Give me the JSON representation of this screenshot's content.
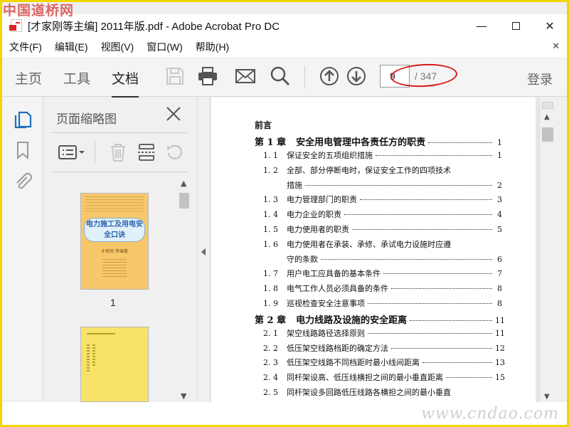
{
  "watermark": {
    "top": "中国道桥网",
    "bottom": "www.cndao.com"
  },
  "window": {
    "title": "[才家刚等主编] 2011年版.pdf - Adobe Acrobat Pro DC"
  },
  "menu": [
    "文件(F)",
    "编辑(E)",
    "视图(V)",
    "窗口(W)",
    "帮助(H)"
  ],
  "toolbar": {
    "tabs": [
      "主页",
      "工具",
      "文档"
    ],
    "active_tab": "文档",
    "current_page": "9",
    "total_pages": "/ 347",
    "login": "登录"
  },
  "thumbnails": {
    "title": "页面缩略图",
    "page1_title": "电力施工及用电安全口诀",
    "page1_author": "才家刚  等编著",
    "page1_number": "1"
  },
  "toc": {
    "heading": "前言",
    "entries": [
      {
        "type": "chapter",
        "num": "第 1 章",
        "text": "安全用电管理中各责任方的职责",
        "page": "1"
      },
      {
        "type": "section",
        "num": "1. 1",
        "text": "保证安全的五项组织措施",
        "page": "1"
      },
      {
        "type": "section",
        "num": "1. 2",
        "text": "全部、部分停断电时，保证安全工作的四项技术",
        "page": ""
      },
      {
        "type": "cont",
        "num": "",
        "text": "措施",
        "page": "2"
      },
      {
        "type": "section",
        "num": "1. 3",
        "text": "电力管理部门的职责",
        "page": "3"
      },
      {
        "type": "section",
        "num": "1. 4",
        "text": "电力企业的职责",
        "page": "4"
      },
      {
        "type": "section",
        "num": "1. 5",
        "text": "电力使用者的职责",
        "page": "5"
      },
      {
        "type": "section",
        "num": "1. 6",
        "text": "电力使用者在承装、承修、承试电力设施时应遵",
        "page": ""
      },
      {
        "type": "cont",
        "num": "",
        "text": "守的条款",
        "page": "6"
      },
      {
        "type": "section",
        "num": "1. 7",
        "text": "用户电工应具备的基本条件",
        "page": "7"
      },
      {
        "type": "section",
        "num": "1. 8",
        "text": "电气工作人员必须具备的条件",
        "page": "8"
      },
      {
        "type": "section",
        "num": "1. 9",
        "text": "巡视检查安全注意事项",
        "page": "8"
      },
      {
        "type": "chapter",
        "num": "第 2 章",
        "text": "电力线路及设施的安全距离",
        "page": "11"
      },
      {
        "type": "section",
        "num": "2. 1",
        "text": "架空线路路径选择原则",
        "page": "11"
      },
      {
        "type": "section",
        "num": "2. 2",
        "text": "低压架空线路档距的确定方法",
        "page": "12"
      },
      {
        "type": "section",
        "num": "2. 3",
        "text": "低压架空线路不同档距时最小线间距离",
        "page": "13"
      },
      {
        "type": "section",
        "num": "2. 4",
        "text": "同杆架设高、低压线横担之间的最小垂直距离",
        "page": "15"
      },
      {
        "type": "section",
        "num": "2. 5",
        "text": "同杆架设多回路低压线路各横担之间的最小垂直",
        "page": ""
      }
    ]
  },
  "colors": {
    "accent": "#1f6fb9",
    "highlight": "#d71818",
    "frame": "#f2d600"
  }
}
